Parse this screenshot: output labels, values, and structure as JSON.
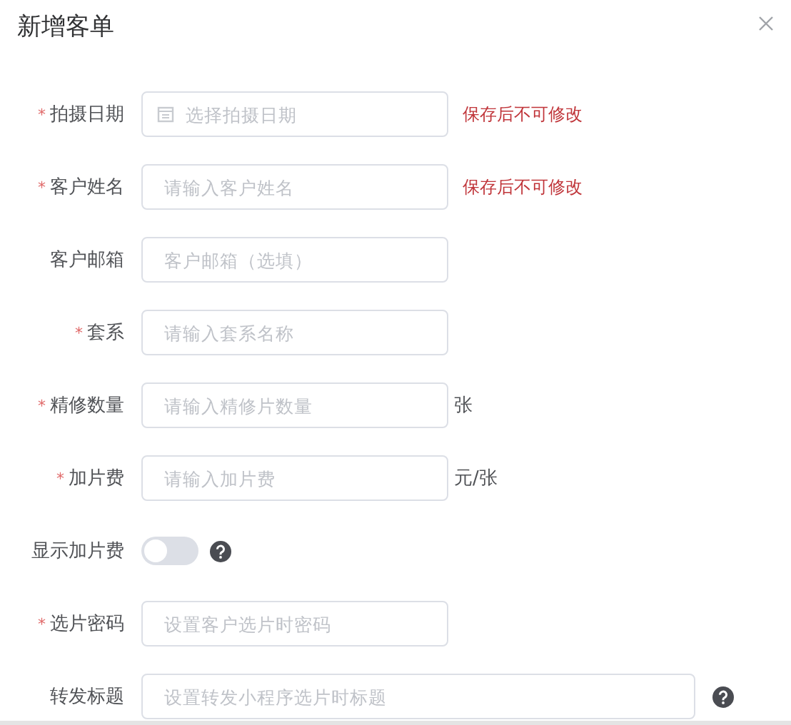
{
  "dialog": {
    "title": "新增客单"
  },
  "fields": [
    {
      "kind": "date",
      "label": "拍摄日期",
      "marker": "*",
      "placeholder": "选择拍摄日期",
      "note": "保存后不可修改"
    },
    {
      "kind": "text",
      "label": "客户姓名",
      "marker": "*",
      "placeholder": "请输入客户姓名",
      "note": "保存后不可修改"
    },
    {
      "kind": "text",
      "label": "客户邮箱",
      "placeholder": "客户邮箱（选填）"
    },
    {
      "kind": "text",
      "label": "套系",
      "marker": "*",
      "placeholder": "请输入套系名称"
    },
    {
      "kind": "text",
      "label": "精修数量",
      "marker": "*",
      "placeholder": "请输入精修片数量",
      "suffix": "张"
    },
    {
      "kind": "text",
      "label": "加片费",
      "marker": "*",
      "placeholder": "请输入加片费",
      "suffix": "元/张"
    },
    {
      "kind": "switch",
      "label": "显示加片费",
      "on": false,
      "help": true
    },
    {
      "kind": "text",
      "label": "选片密码",
      "marker": "*",
      "placeholder": "设置客户选片时密码"
    },
    {
      "kind": "wide",
      "label": "转发标题",
      "placeholder": "设置转发小程序选片时标题",
      "help": true
    }
  ]
}
